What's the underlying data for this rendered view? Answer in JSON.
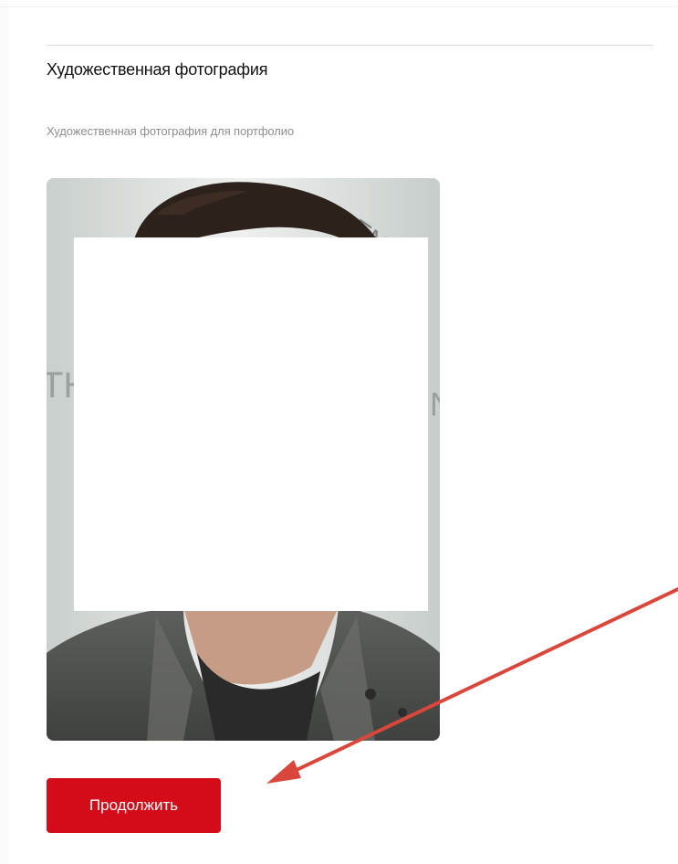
{
  "section": {
    "title": "Художественная фотография",
    "description": "Художественная фотография для портфолио"
  },
  "photo": {
    "alt": "Художественная фотография"
  },
  "actions": {
    "continue_label": "Продолжить"
  },
  "colors": {
    "accent": "#d40c19",
    "annotation_arrow": "#d9473c",
    "title_text": "#111111",
    "muted_text": "#8e8e8e"
  },
  "icons": {
    "annotation": "arrow-pointer-icon"
  }
}
